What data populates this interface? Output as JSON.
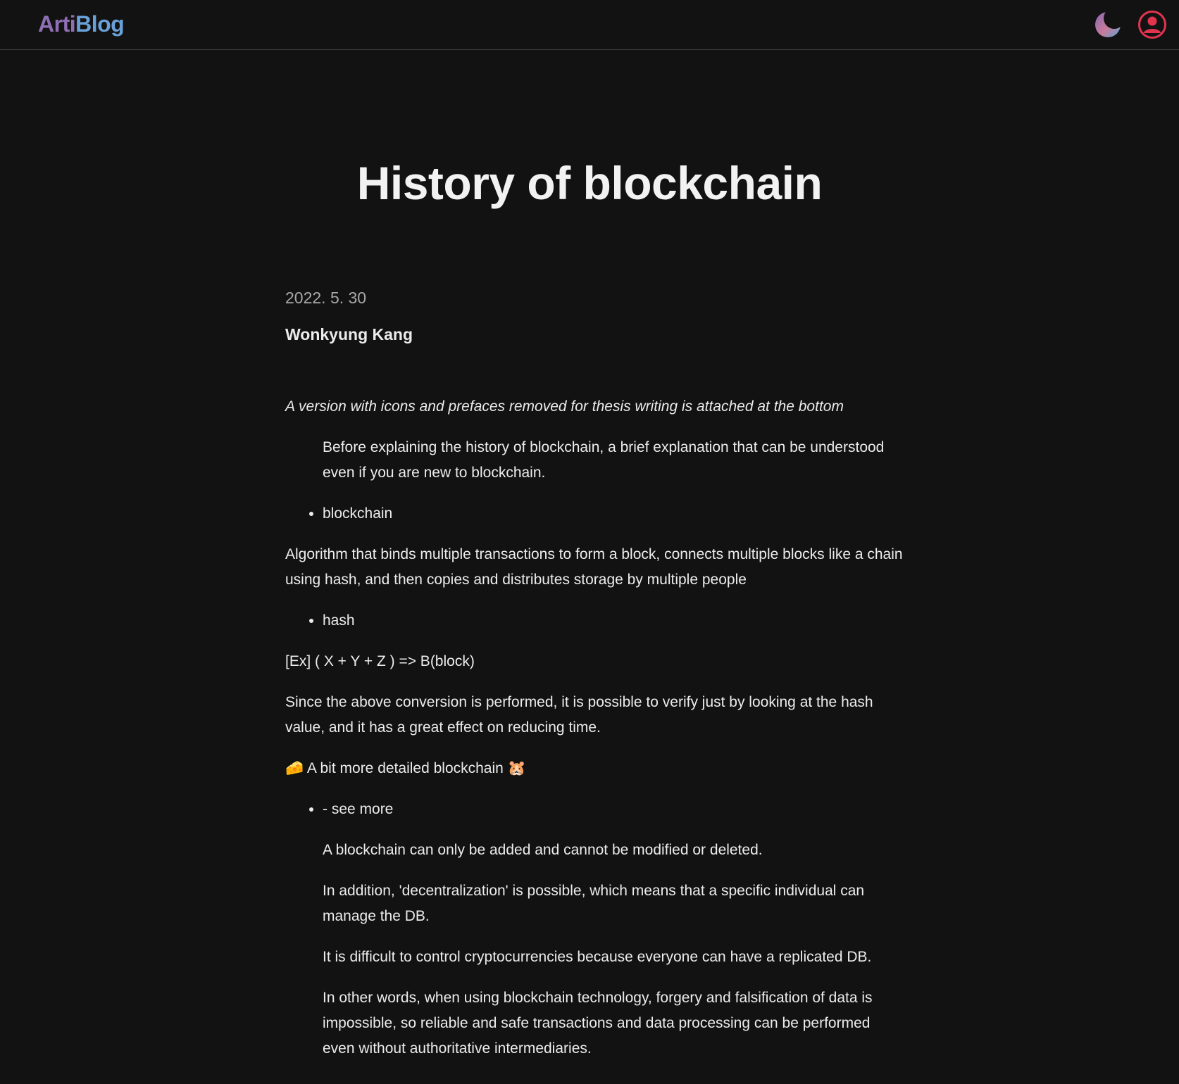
{
  "header": {
    "logo_part1": "Arti",
    "logo_part2": "Blog",
    "theme_toggle_icon": "moon-icon",
    "profile_icon": "user-circle-icon",
    "colors": {
      "logo_part1": "#8e6fb5",
      "logo_part2": "#6aa0d8",
      "profile": "#e2344f",
      "background": "#121212"
    }
  },
  "post": {
    "title": "History of blockchain",
    "date": "2022. 5. 30",
    "author": "Wonkyung Kang",
    "intro": "A version with icons and prefaces removed for thesis writing is attached at the bottom",
    "preface": "Before explaining the history of blockchain, a brief explanation that can be understood even if you are new to blockchain.",
    "bullet_blockchain": "blockchain",
    "blockchain_definition": "Algorithm that binds multiple transactions to form a block, connects multiple blocks like a chain using hash, and then copies and distributes storage by multiple people",
    "bullet_hash": "hash",
    "hash_example": "[Ex] ( X + Y + Z ) => B(block)",
    "hash_explanation": "Since the above conversion is performed, it is possible to verify just by looking at the hash value, and it has a great effect on reducing time.",
    "detailed_heading": "🧀 A bit more detailed blockchain 🐹",
    "see_more": "- see more",
    "details": [
      "A blockchain can only be added and cannot be modified or deleted.",
      "In addition, 'decentralization' is possible, which means that a specific individual can manage the DB.",
      "It is difficult to control cryptocurrencies because everyone can have a replicated DB.",
      "In other words, when using blockchain technology, forgery and falsification of data is impossible, so reliable and safe transactions and data processing can be performed even without authoritative intermediaries."
    ]
  }
}
